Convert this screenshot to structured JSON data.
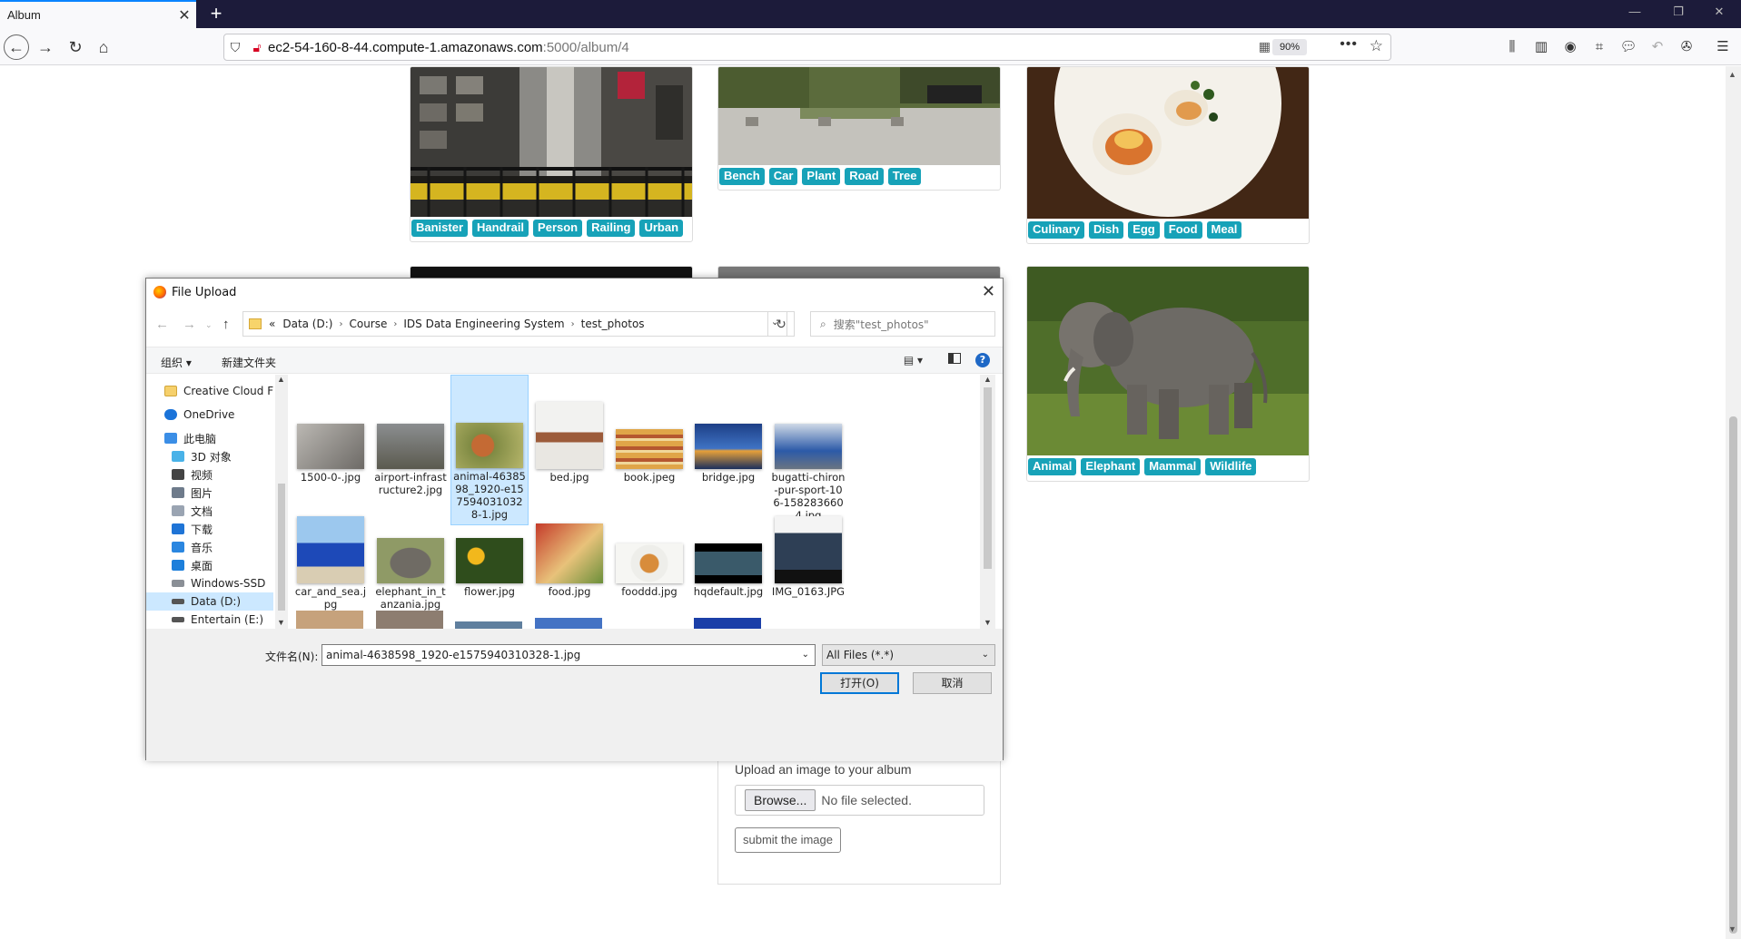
{
  "browser": {
    "tab_title": "Album",
    "tab_close": "✕",
    "new_tab": "+",
    "window_controls": [
      "—",
      "❐",
      "✕"
    ],
    "url_host": "ec2-54-160-8-44.compute-1.amazonaws.com",
    "url_path": ":5000/album/4",
    "zoom": "90%",
    "icons": {
      "back": "back-arrow-icon",
      "forward": "forward-arrow-icon",
      "reload": "reload-icon",
      "home": "home-icon",
      "shield": "tracking-shield-icon",
      "insecure": "insecure-lock-icon",
      "qr": "qr-code-icon",
      "more": "page-actions-icon",
      "bookmark": "bookmark-star-icon"
    }
  },
  "album": {
    "cards": [
      {
        "tags": [
          "Banister",
          "Handrail",
          "Person",
          "Railing",
          "Urban"
        ]
      },
      {
        "tags": [
          "Bench",
          "Car",
          "Plant",
          "Road",
          "Tree"
        ]
      },
      {
        "tags": [
          "Culinary",
          "Dish",
          "Egg",
          "Food",
          "Meal"
        ]
      },
      {
        "tags": [
          "Animal",
          "Elephant",
          "Mammal",
          "Wildlife"
        ]
      }
    ],
    "tag_color": "#17a2b8",
    "upload": {
      "label": "Upload an image to your album",
      "browse": "Browse...",
      "no_file": "No file selected.",
      "submit": "submit the image"
    }
  },
  "dialog": {
    "title": "File Upload",
    "close": "✕",
    "breadcrumb": [
      "Data (D:)",
      "Course",
      "IDS Data Engineering System",
      "test_photos"
    ],
    "breadcrumb_prefix": "«",
    "search_placeholder": "搜索\"test_photos\"",
    "organize": "组织 ▾",
    "new_folder": "新建文件夹",
    "help": "?",
    "nav_items": [
      {
        "label": "Creative Cloud F",
        "icon": "creative-cloud-icon"
      },
      {
        "label": "OneDrive",
        "icon": "onedrive-cloud-icon"
      },
      {
        "label": "此电脑",
        "icon": "this-pc-icon"
      },
      {
        "label": "3D 对象",
        "icon": "3d-objects-icon"
      },
      {
        "label": "视频",
        "icon": "videos-icon"
      },
      {
        "label": "图片",
        "icon": "pictures-icon"
      },
      {
        "label": "文档",
        "icon": "documents-icon"
      },
      {
        "label": "下载",
        "icon": "downloads-icon"
      },
      {
        "label": "音乐",
        "icon": "music-icon"
      },
      {
        "label": "桌面",
        "icon": "desktop-icon"
      },
      {
        "label": "Windows-SSD",
        "icon": "windows-drive-icon"
      },
      {
        "label": "Data (D:)",
        "icon": "drive-icon"
      },
      {
        "label": "Entertain (E:)",
        "icon": "drive-icon"
      }
    ],
    "selected_nav": "Data (D:)",
    "files": [
      {
        "name": "1500-0-.jpg"
      },
      {
        "name": "airport-infrastructure2.jpg"
      },
      {
        "name": "animal-4638598_1920-e1575940310328-1.jpg"
      },
      {
        "name": "bed.jpg"
      },
      {
        "name": "book.jpeg"
      },
      {
        "name": "bridge.jpg"
      },
      {
        "name": "bugatti-chiron-pur-sport-106-1582836604.jpg"
      },
      {
        "name": "car_and_sea.jpg"
      },
      {
        "name": "elephant_in_tanzania.jpg"
      },
      {
        "name": "flower.jpg"
      },
      {
        "name": "food.jpg"
      },
      {
        "name": "fooddd.jpg"
      },
      {
        "name": "hqdefault.jpg"
      },
      {
        "name": "IMG_0163.JPG"
      }
    ],
    "selected_file": "animal-4638598_1920-e1575940310328-1.jpg",
    "filename_label": "文件名(N):",
    "filename_value": "animal-4638598_1920-e1575940310328-1.jpg",
    "filetype": "All Files (*.*)",
    "open": "打开(O)",
    "cancel": "取消"
  }
}
